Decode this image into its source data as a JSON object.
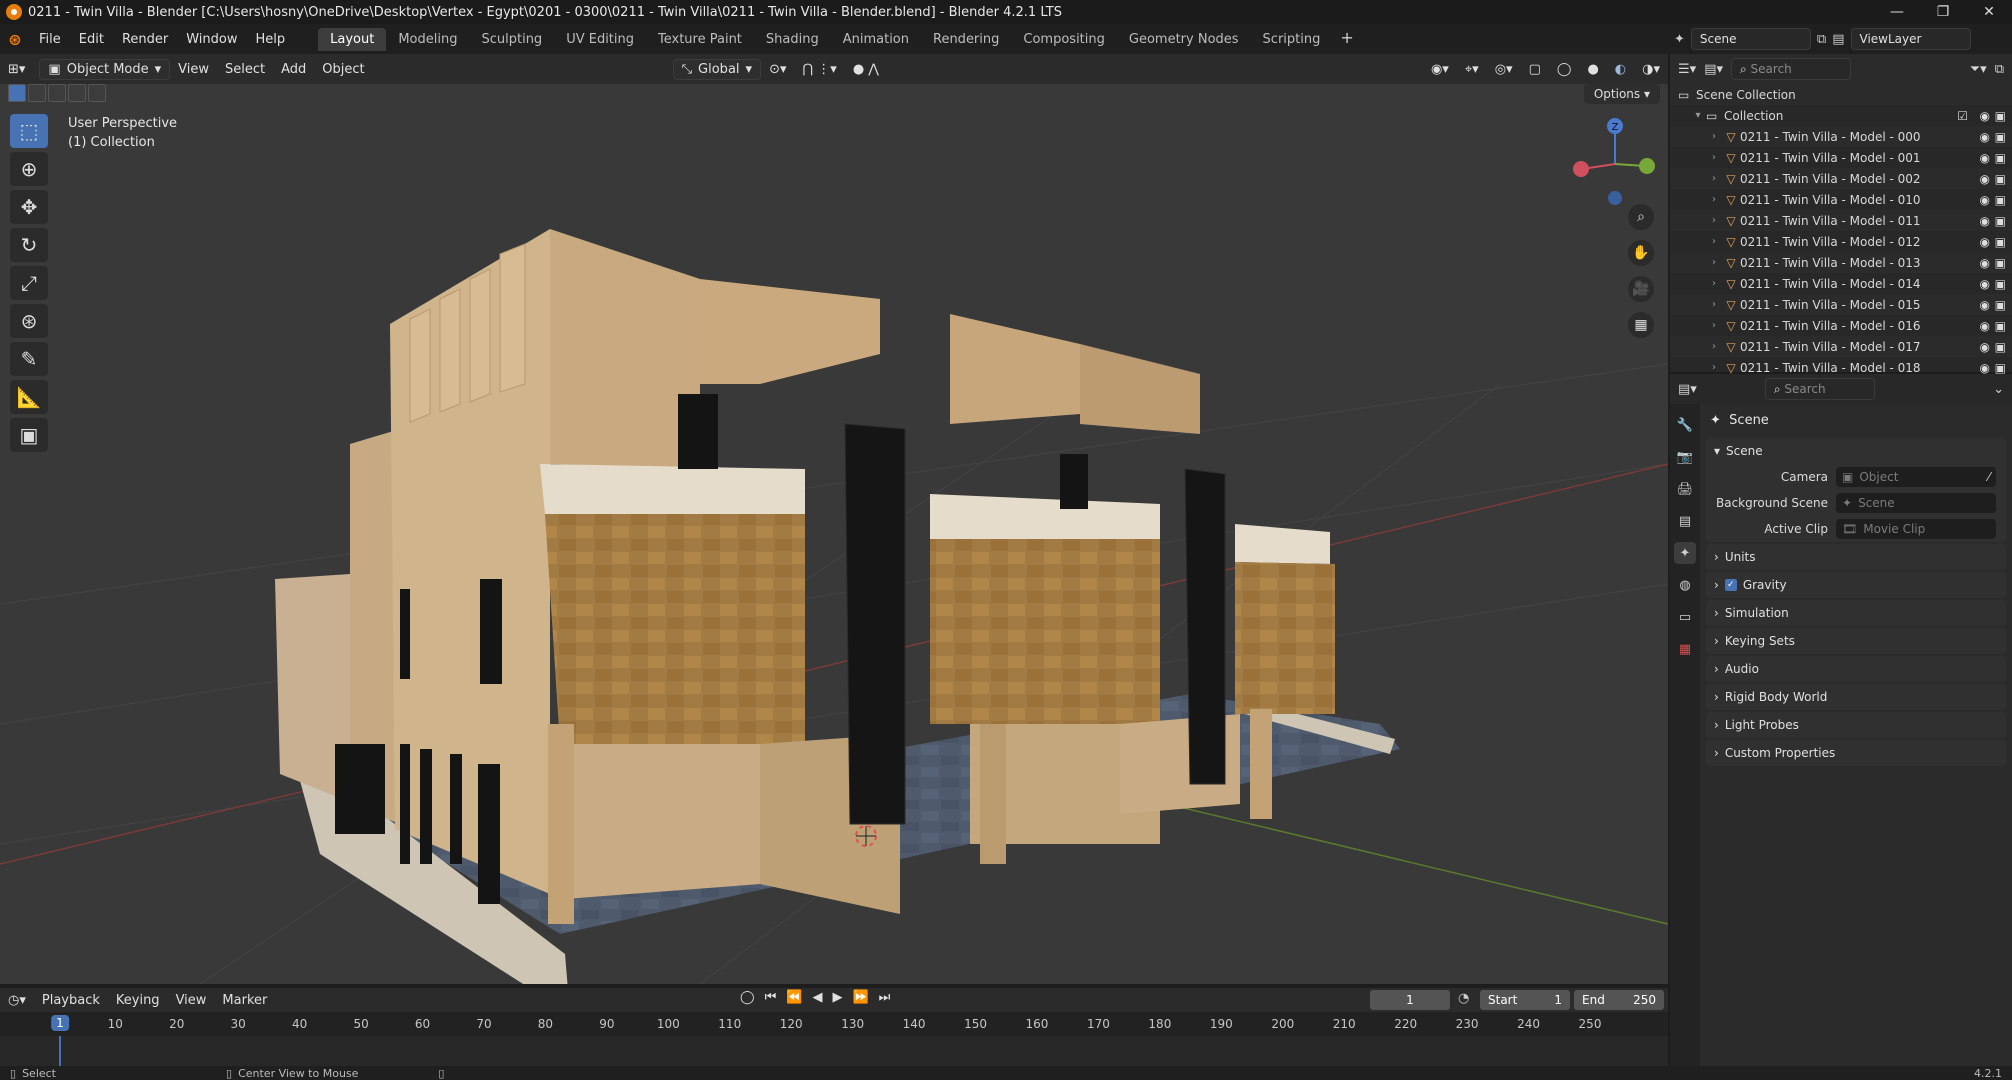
{
  "window": {
    "title": "0211 - Twin Villa - Blender [C:\\Users\\hosny\\OneDrive\\Desktop\\Vertex - Egypt\\0201 - 0300\\0211 - Twin Villa\\0211 - Twin Villa - Blender.blend] - Blender 4.2.1 LTS",
    "minimize": "—",
    "maximize": "❐",
    "close": "✕"
  },
  "menu": [
    "File",
    "Edit",
    "Render",
    "Window",
    "Help"
  ],
  "workspaces": [
    "Layout",
    "Modeling",
    "Sculpting",
    "UV Editing",
    "Texture Paint",
    "Shading",
    "Animation",
    "Rendering",
    "Compositing",
    "Geometry Nodes",
    "Scripting"
  ],
  "scene_selector": {
    "scene": "Scene",
    "view_layer": "ViewLayer"
  },
  "viewport_header": {
    "mode": "Object Mode",
    "menus": [
      "View",
      "Select",
      "Add",
      "Object"
    ],
    "transform_orientation": "Global",
    "options_label": "Options"
  },
  "viewport": {
    "perspective_label": "User Perspective",
    "collection_label": "(1) Collection",
    "gizmo_z": "Z"
  },
  "outliner": {
    "search_placeholder": "Search",
    "scene_collection": "Scene Collection",
    "collection": "Collection",
    "items": [
      "0211 - Twin Villa - Model - 000",
      "0211 - Twin Villa - Model - 001",
      "0211 - Twin Villa - Model - 002",
      "0211 - Twin Villa - Model - 010",
      "0211 - Twin Villa - Model - 011",
      "0211 - Twin Villa - Model - 012",
      "0211 - Twin Villa - Model - 013",
      "0211 - Twin Villa - Model - 014",
      "0211 - Twin Villa - Model - 015",
      "0211 - Twin Villa - Model - 016",
      "0211 - Twin Villa - Model - 017",
      "0211 - Twin Villa - Model - 018"
    ]
  },
  "properties": {
    "search_placeholder": "Search",
    "context": "Scene",
    "scene_panel": "Scene",
    "camera_label": "Camera",
    "camera_value": "Object",
    "bg_scene_label": "Background Scene",
    "bg_scene_value": "Scene",
    "active_clip_label": "Active Clip",
    "active_clip_value": "Movie Clip",
    "panels": [
      "Units",
      "Gravity",
      "Simulation",
      "Keying Sets",
      "Audio",
      "Rigid Body World",
      "Light Probes",
      "Custom Properties"
    ]
  },
  "timeline": {
    "menus": [
      "Playback",
      "Keying",
      "View",
      "Marker"
    ],
    "current_frame": "1",
    "start_label": "Start",
    "start": "1",
    "end_label": "End",
    "end": "250",
    "ticks": [
      "10",
      "20",
      "30",
      "40",
      "50",
      "60",
      "70",
      "80",
      "90",
      "100",
      "110",
      "120",
      "130",
      "140",
      "150",
      "160",
      "170",
      "180",
      "190",
      "200",
      "210",
      "220",
      "230",
      "240",
      "250"
    ]
  },
  "statusbar": {
    "left": "Select",
    "middle": "Center View to Mouse",
    "version": "4.2.1"
  },
  "colors": {
    "accent": "#4772b3",
    "brand": "#e87d0d"
  }
}
